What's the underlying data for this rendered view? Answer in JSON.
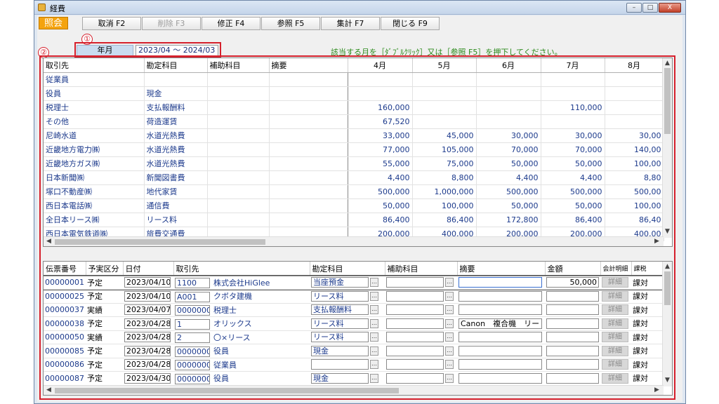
{
  "window": {
    "title": "経費",
    "icon": "app-icon",
    "min": "–",
    "max": "□",
    "close": "X"
  },
  "mode_label": "照会",
  "fkeys": [
    {
      "label": "取消 F2",
      "enabled": true
    },
    {
      "label": "削除 F3",
      "enabled": false
    },
    {
      "label": "修正 F4",
      "enabled": true
    },
    {
      "label": "参照 F5",
      "enabled": true
    },
    {
      "label": "集計 F7",
      "enabled": true
    },
    {
      "label": "閉じる F9",
      "enabled": true
    }
  ],
  "annot": {
    "one": "①",
    "two": "②"
  },
  "period": {
    "label": "年月",
    "value": "2023/04 ～ 2024/03"
  },
  "hint": "該当する月を［ﾀﾞﾌﾞﾙｸﾘｯｸ］又は［参照 F5］を押下してください。",
  "summary": {
    "headers": [
      "取引先",
      "勘定科目",
      "補助科目",
      "摘要",
      "4月",
      "5月",
      "6月",
      "7月",
      "8月"
    ],
    "rows": [
      [
        "従業員",
        "",
        "",
        "",
        "",
        "",
        "",
        "",
        ""
      ],
      [
        "役員",
        "現金",
        "",
        "",
        "",
        "",
        "",
        "",
        ""
      ],
      [
        "税理士",
        "支払報酬料",
        "",
        "",
        "160,000",
        "",
        "",
        "110,000",
        ""
      ],
      [
        "その他",
        "荷造運賃",
        "",
        "",
        "67,520",
        "",
        "",
        "",
        ""
      ],
      [
        "尼崎水道",
        "水道光熱費",
        "",
        "",
        "33,000",
        "45,000",
        "30,000",
        "30,000",
        "30,00"
      ],
      [
        "近畿地方電力㈱",
        "水道光熱費",
        "",
        "",
        "77,000",
        "105,000",
        "70,000",
        "70,000",
        "140,00"
      ],
      [
        "近畿地方ガス㈱",
        "水道光熱費",
        "",
        "",
        "55,000",
        "75,000",
        "50,000",
        "50,000",
        "100,00"
      ],
      [
        "日本新聞㈱",
        "新聞図書費",
        "",
        "",
        "4,400",
        "8,800",
        "4,400",
        "4,400",
        "8,80"
      ],
      [
        "塚口不動産㈱",
        "地代家賃",
        "",
        "",
        "500,000",
        "1,000,000",
        "500,000",
        "500,000",
        "500,00"
      ],
      [
        "西日本電話㈱",
        "通信費",
        "",
        "",
        "50,000",
        "100,000",
        "50,000",
        "50,000",
        "100,00"
      ],
      [
        "全日本リース㈱",
        "リース料",
        "",
        "",
        "86,400",
        "86,400",
        "172,800",
        "86,400",
        "86,40"
      ],
      [
        "西日本電気鉄道㈱",
        "旅費交通費",
        "",
        "",
        "200,000",
        "400,000",
        "200,000",
        "200,000",
        "400,00"
      ]
    ]
  },
  "detail": {
    "headers": [
      "伝票番号",
      "予実区分",
      "日付",
      "取引先",
      "勘定科目",
      "補助科目",
      "摘要",
      "金額",
      "会計明細",
      "課税"
    ],
    "detail_btn": "詳細",
    "rows": [
      {
        "no": "00000001",
        "kubun": "予定",
        "date": "2023/04/10",
        "code": "1100",
        "partner": "株式会社HiGlee",
        "account": "当座預金",
        "sub": "",
        "memo": "",
        "amount": "50,000",
        "tax": "課対"
      },
      {
        "no": "00000025",
        "kubun": "予定",
        "date": "2023/04/10",
        "code": "A001",
        "partner": "クボタ建機",
        "account": "リース料",
        "sub": "",
        "memo": "",
        "amount": "",
        "tax": "課対"
      },
      {
        "no": "00000037",
        "kubun": "実績",
        "date": "2023/04/07",
        "code": "00000004",
        "partner": "税理士",
        "account": "支払報酬料",
        "sub": "",
        "memo": "",
        "amount": "",
        "tax": "課対"
      },
      {
        "no": "00000038",
        "kubun": "予定",
        "date": "2023/04/28",
        "code": "1",
        "partner": "オリックス",
        "account": "リース料",
        "sub": "",
        "memo": "Canon　複合機　リー",
        "amount": "",
        "tax": "課対"
      },
      {
        "no": "00000050",
        "kubun": "実績",
        "date": "2023/04/28",
        "code": "2",
        "partner": "〇×リース",
        "account": "リース料",
        "sub": "",
        "memo": "",
        "amount": "",
        "tax": "課対"
      },
      {
        "no": "00000085",
        "kubun": "予定",
        "date": "2023/04/28",
        "code": "00000002",
        "partner": "役員",
        "account": "現金",
        "sub": "",
        "memo": "",
        "amount": "",
        "tax": "課対"
      },
      {
        "no": "00000086",
        "kubun": "予定",
        "date": "2023/04/28",
        "code": "00000001",
        "partner": "従業員",
        "account": "",
        "sub": "",
        "memo": "",
        "amount": "",
        "tax": "課対"
      },
      {
        "no": "00000087",
        "kubun": "予定",
        "date": "2023/04/30",
        "code": "00000002",
        "partner": "役員",
        "account": "現金",
        "sub": "",
        "memo": "",
        "amount": "",
        "tax": "課対"
      }
    ]
  }
}
